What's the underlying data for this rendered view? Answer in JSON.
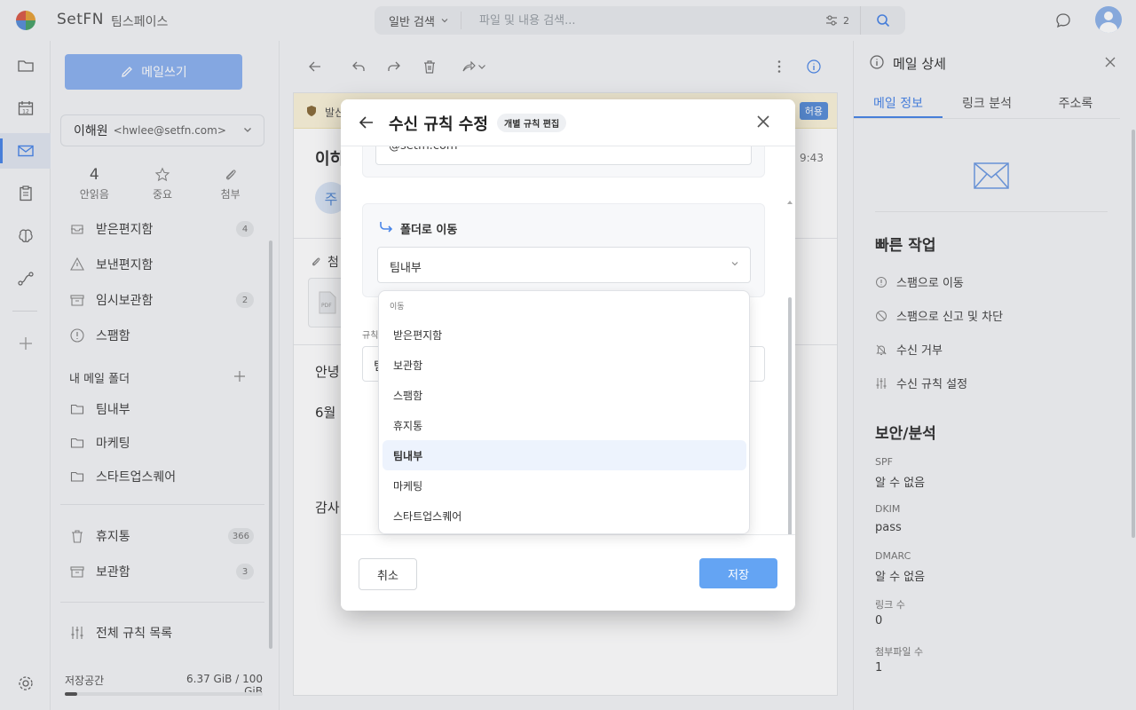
{
  "app": {
    "brand": "SetFN",
    "workspace": "팀스페이스"
  },
  "search": {
    "type_label": "일반 검색",
    "placeholder": "파일 및 내용 검색...",
    "filter_count": "2"
  },
  "sidebar": {
    "compose_label": "메일쓰기",
    "account": {
      "name": "이해원",
      "email": "<hwlee@setfn.com>"
    },
    "stats": [
      {
        "value": "4",
        "label": "안읽음"
      },
      {
        "value": "",
        "label": "중요",
        "icon": "star-icon"
      },
      {
        "value": "",
        "label": "첨부",
        "icon": "paperclip-icon"
      }
    ],
    "folders": [
      {
        "label": "받은편지함",
        "count": "4",
        "icon": "inbox-icon"
      },
      {
        "label": "보낸편지함",
        "count": "",
        "icon": "send-icon"
      },
      {
        "label": "임시보관함",
        "count": "2",
        "icon": "archive-icon"
      },
      {
        "label": "스팸함",
        "count": "",
        "icon": "alert-circle-icon"
      }
    ],
    "my_folders_title": "내 메일 폴더",
    "my_folders": [
      {
        "label": "팀내부",
        "icon": "folder-icon"
      },
      {
        "label": "마케팅",
        "icon": "folder-icon"
      },
      {
        "label": "스타트업스퀘어",
        "icon": "folder-icon"
      }
    ],
    "system_folders": [
      {
        "label": "휴지통",
        "count": "366",
        "icon": "trash-icon"
      },
      {
        "label": "보관함",
        "count": "3",
        "icon": "archive-icon"
      }
    ],
    "rules_link": "전체 규칙 목록",
    "storage": {
      "label": "저장공간",
      "value": "6.37 GiB / 100 GiB",
      "fraction": 0.064
    }
  },
  "mail": {
    "warning_text": "발신",
    "allow_label": "허용",
    "subject_fragment": "이히",
    "time_fragment": "9:43",
    "avatar_letter": "주",
    "attach_fragment": "첨",
    "body_lines": [
      "안녕",
      "6월",
      "감사"
    ]
  },
  "right_panel": {
    "title": "메일 상세",
    "tabs": [
      "메일 정보",
      "링크 분석",
      "주소록"
    ],
    "quick_title": "빠른 작업",
    "actions": [
      {
        "label": "스팸으로 이동",
        "icon": "alert-circle-icon"
      },
      {
        "label": "스팸으로 신고 및 차단",
        "icon": "block-icon"
      },
      {
        "label": "수신 거부",
        "icon": "bell-off-icon"
      },
      {
        "label": "수신 규칙 설정",
        "icon": "sliders-icon"
      }
    ],
    "security_title": "보안/분석",
    "fields": [
      {
        "label": "SPF",
        "value": "알 수 없음"
      },
      {
        "label": "DKIM",
        "value": "pass"
      },
      {
        "label": "DMARC",
        "value": "알 수 없음"
      },
      {
        "label": "링크 수",
        "value": "0"
      },
      {
        "label": "첨부파일 수",
        "value": "1"
      }
    ]
  },
  "modal": {
    "title": "수신 규칙 수정",
    "badge": "개별 규칙 편집",
    "prev_value": "@setfn.com",
    "move_title": "폴더로 이동",
    "selected_folder": "팀내부",
    "rule_label": "규칙",
    "rule_value": "팀",
    "cancel_label": "취소",
    "save_label": "저장"
  },
  "dropdown": {
    "group_label": "이동",
    "options": [
      "받은편지함",
      "보관함",
      "스팸함",
      "휴지통",
      "팀내부",
      "마케팅",
      "스타트업스퀘어"
    ],
    "selected": "팀내부"
  }
}
